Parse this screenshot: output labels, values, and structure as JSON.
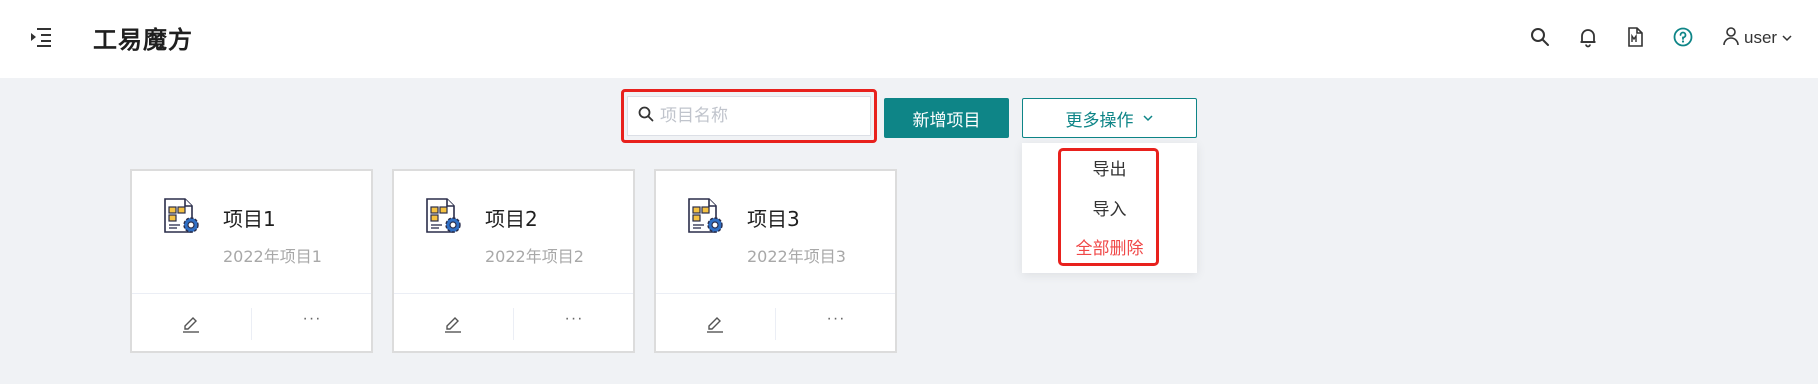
{
  "header": {
    "title": "工易魔方",
    "user_label": "user",
    "icons": [
      "menu-fold-icon",
      "search-icon",
      "bell-icon",
      "markdown-doc-icon",
      "help-circle-icon",
      "user-icon",
      "chevron-down-icon"
    ]
  },
  "toolbar": {
    "search_placeholder": "项目名称",
    "search_value": "",
    "add_label": "新增项目",
    "more_label": "更多操作"
  },
  "dropdown": {
    "items": [
      {
        "label": "导出"
      },
      {
        "label": "导入"
      },
      {
        "label": "全部删除"
      }
    ]
  },
  "projects": [
    {
      "name": "项目1",
      "desc": "2022年项目1"
    },
    {
      "name": "项目2",
      "desc": "2022年项目2"
    },
    {
      "name": "项目3",
      "desc": "2022年项目3"
    }
  ],
  "colors": {
    "primary": "#0e8587",
    "danger": "#f04848",
    "highlight_outline": "#e8211d",
    "background": "#f0f2f5",
    "help_icon": "#0e8587"
  },
  "card_more_text": "···"
}
